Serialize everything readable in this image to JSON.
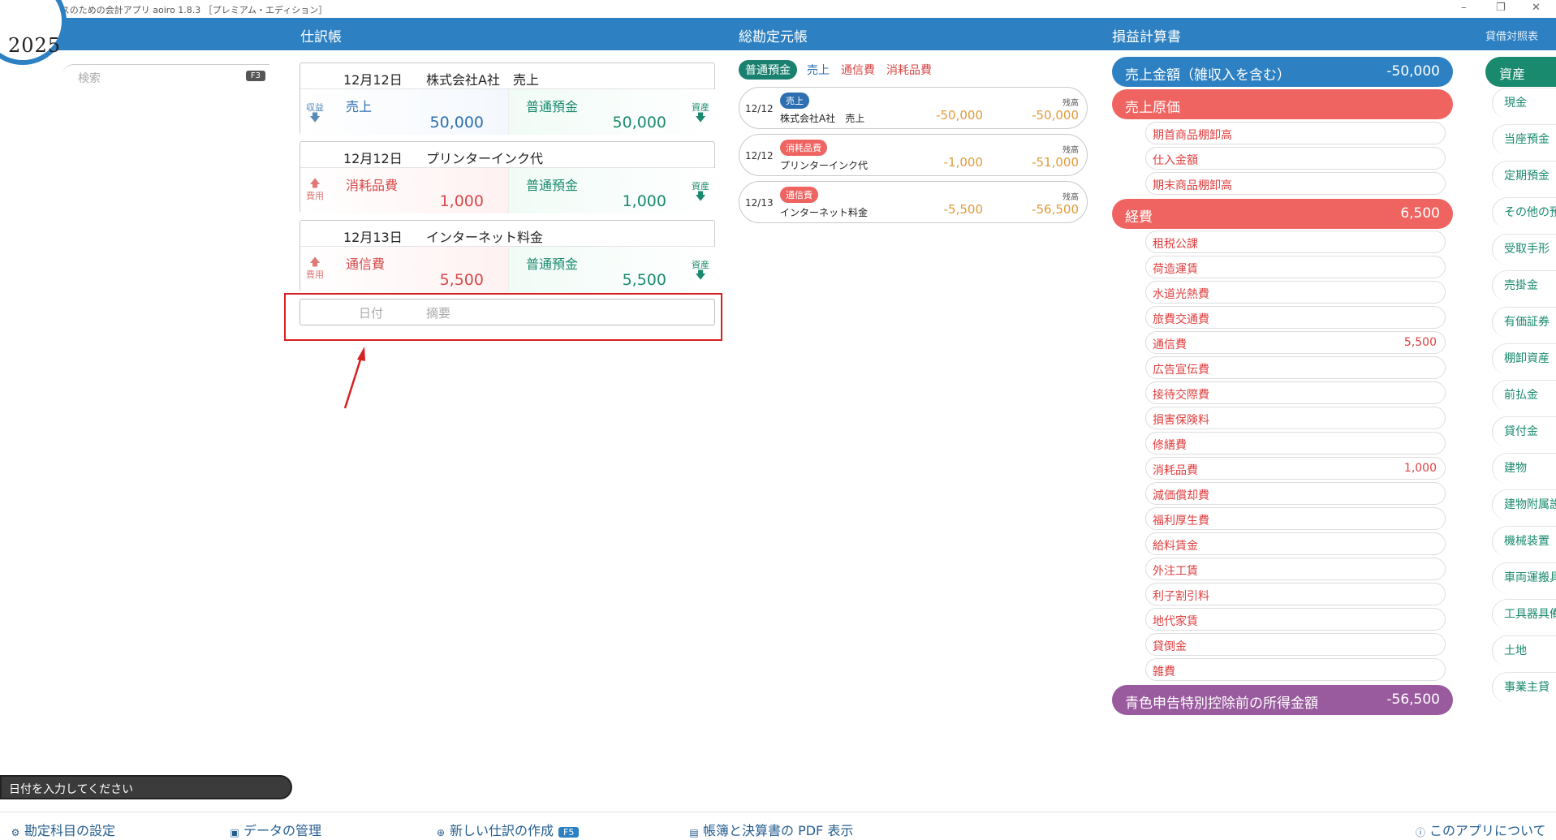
{
  "window": {
    "title": "フリーランスのための会計アプリ aoiro 1.8.3 ［プレミアム・エディション］",
    "minimize": "–",
    "restore": "❐",
    "close": "✕"
  },
  "year": "2025",
  "sections": {
    "journal": "仕訳帳",
    "ledger": "総勘定元帳",
    "pl": "損益計算書",
    "bs": "貸借対照表"
  },
  "search": {
    "placeholder": "検索",
    "shortcut": "F3"
  },
  "journal": [
    {
      "date": "12月12日",
      "memo": "株式会社A社　売上",
      "left_side": "収益",
      "debit": {
        "account": "売上",
        "amount": "50,000"
      },
      "credit": {
        "account": "普通預金",
        "amount": "50,000"
      },
      "right_side": "資産"
    },
    {
      "date": "12月12日",
      "memo": "プリンターインク代",
      "left_side": "費用",
      "debit": {
        "account": "消耗品費",
        "amount": "1,000"
      },
      "credit": {
        "account": "普通預金",
        "amount": "1,000"
      },
      "right_side": "資産"
    },
    {
      "date": "12月13日",
      "memo": "インターネット料金",
      "left_side": "費用",
      "debit": {
        "account": "通信費",
        "amount": "5,500"
      },
      "credit": {
        "account": "普通預金",
        "amount": "5,500"
      },
      "right_side": "資産"
    }
  ],
  "new_entry": {
    "date_placeholder": "日付",
    "memo_placeholder": "摘要"
  },
  "ledger_tabs": [
    "普通預金",
    "売上",
    "通信費",
    "消耗品費"
  ],
  "ledger_balance_label": "残高",
  "ledger": [
    {
      "date": "12/12",
      "tag": "売上",
      "name": "株式会社A社　売上",
      "amount": "-50,000",
      "balance": "-50,000"
    },
    {
      "date": "12/12",
      "tag": "消耗品費",
      "name": "プリンターインク代",
      "amount": "-1,000",
      "balance": "-51,000"
    },
    {
      "date": "12/13",
      "tag": "通信費",
      "name": "インターネット料金",
      "amount": "-5,500",
      "balance": "-56,500"
    }
  ],
  "pl": {
    "sales": {
      "label": "売上金額（雑収入を含む）",
      "value": "-50,000"
    },
    "cogs": {
      "label": "売上原価",
      "items": [
        "期首商品棚卸高",
        "仕入金額",
        "期末商品棚卸高"
      ]
    },
    "expenses": {
      "label": "経費",
      "value": "6,500",
      "items": [
        {
          "name": "租税公課",
          "value": ""
        },
        {
          "name": "荷造運賃",
          "value": ""
        },
        {
          "name": "水道光熱費",
          "value": ""
        },
        {
          "name": "旅費交通費",
          "value": ""
        },
        {
          "name": "通信費",
          "value": "5,500"
        },
        {
          "name": "広告宣伝費",
          "value": ""
        },
        {
          "name": "接待交際費",
          "value": ""
        },
        {
          "name": "損害保険料",
          "value": ""
        },
        {
          "name": "修繕費",
          "value": ""
        },
        {
          "name": "消耗品費",
          "value": "1,000"
        },
        {
          "name": "減価償却費",
          "value": ""
        },
        {
          "name": "福利厚生費",
          "value": ""
        },
        {
          "name": "給料賃金",
          "value": ""
        },
        {
          "name": "外注工賃",
          "value": ""
        },
        {
          "name": "利子割引料",
          "value": ""
        },
        {
          "name": "地代家賃",
          "value": ""
        },
        {
          "name": "貸倒金",
          "value": ""
        },
        {
          "name": "雑費",
          "value": ""
        }
      ]
    },
    "income": {
      "label": "青色申告特別控除前の所得金額",
      "value": "-56,500"
    }
  },
  "assets": {
    "label": "資産",
    "items": [
      "現金",
      "当座預金",
      "定期預金",
      "その他の預",
      "受取手形",
      "売掛金",
      "有価証券",
      "棚卸資産",
      "前払金",
      "貸付金",
      "建物",
      "建物附属設",
      "機械装置",
      "車両運搬具",
      "工具器具備",
      "土地",
      "事業主貸"
    ]
  },
  "status": "日付を入力してください",
  "bottom": {
    "settings": "勘定科目の設定",
    "data": "データの管理",
    "new_entry": "新しい仕訳の作成",
    "new_key": "F5",
    "pdf": "帳簿と決算書の PDF 表示",
    "about": "このアプリについて"
  },
  "colors": {
    "header": "#2d80c2",
    "sales": "#2d80c2",
    "cost": "#ef6461",
    "income": "#9a5a9e",
    "asset": "#1a8a6e",
    "ledger_amount": "#e19a3a",
    "highlight": "#d72020"
  }
}
